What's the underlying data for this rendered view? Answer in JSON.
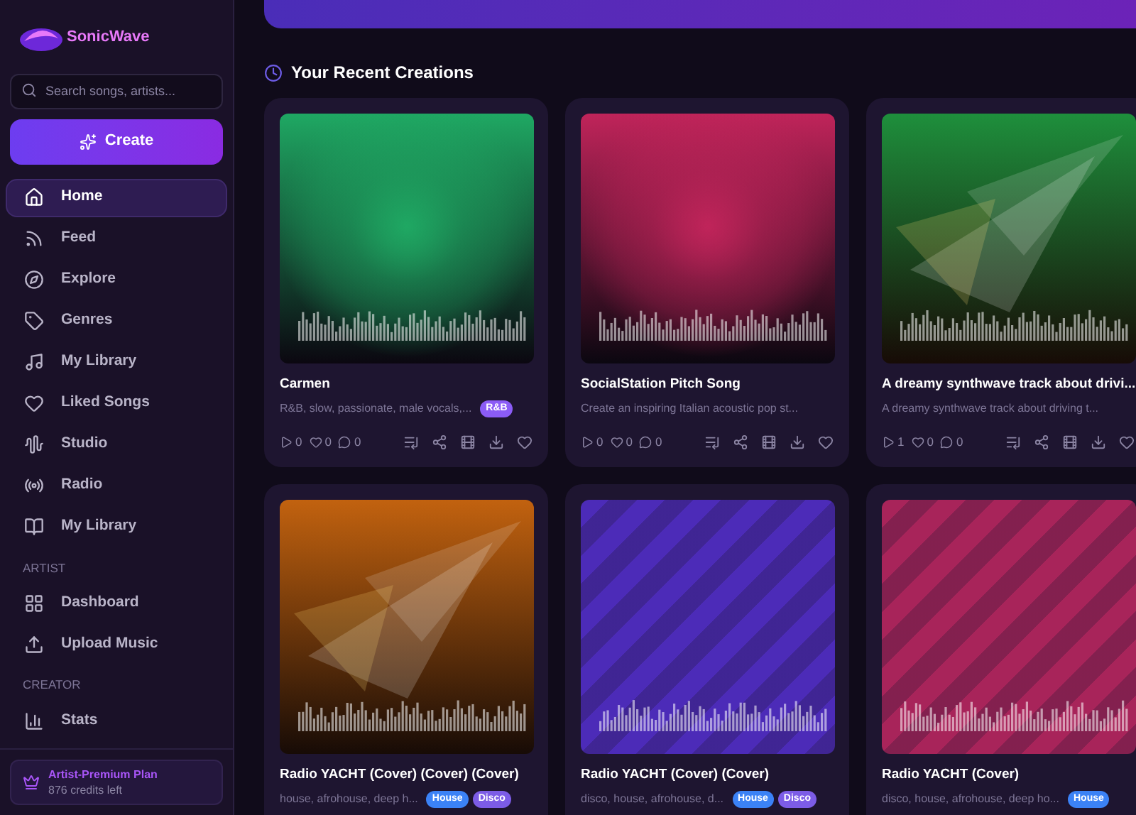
{
  "brand": {
    "name": "SonicWave"
  },
  "search": {
    "placeholder": "Search songs, artists..."
  },
  "create_button": {
    "label": "Create"
  },
  "nav": [
    {
      "label": "Home",
      "selected": true
    },
    {
      "label": "Feed",
      "selected": false
    },
    {
      "label": "Explore",
      "selected": false
    },
    {
      "label": "Genres",
      "selected": false
    },
    {
      "label": "My Library",
      "selected": false
    },
    {
      "label": "Liked Songs",
      "selected": false
    },
    {
      "label": "Studio",
      "selected": false
    },
    {
      "label": "Radio",
      "selected": false
    },
    {
      "label": "My Library",
      "selected": false
    }
  ],
  "sections": [
    {
      "title": "ARTIST",
      "items": [
        {
          "label": "Dashboard",
          "selected": false
        },
        {
          "label": "Upload Music",
          "selected": false
        }
      ]
    },
    {
      "title": "CREATOR",
      "items": [
        {
          "label": "Stats",
          "selected": false
        }
      ]
    }
  ],
  "plan": {
    "name": "Artist-Premium Plan",
    "credits": "876 credits left"
  },
  "heading": "Your Recent Creations",
  "tracks": [
    {
      "title": "Carmen",
      "description": "R&B, slow, passionate, male vocals,...",
      "color": "#1fa863",
      "tags": [
        {
          "label": "R&B",
          "color": "#8b5cf6"
        }
      ],
      "plays": "0",
      "likes": "0",
      "comments": "0"
    },
    {
      "title": "SocialStation Pitch Song",
      "description": "Create an inspiring Italian acoustic pop st...",
      "color": "#c0245a",
      "plays": "0",
      "likes": "0",
      "comments": "0"
    },
    {
      "title": "A dreamy synthwave track about drivi...",
      "description": "A dreamy synthwave track about driving t...",
      "color": "#1e8f3c",
      "plays": "1",
      "likes": "0",
      "comments": "0"
    },
    {
      "title": "Radio YACHT (Cover) (Cover) (Cover)",
      "description": "house, afrohouse, deep h...",
      "color": "#c2620f",
      "tags": [
        {
          "label": "House",
          "color": "#3b82f6"
        },
        {
          "label": "Disco",
          "color": "#7c5ce6"
        }
      ]
    },
    {
      "title": "Radio YACHT (Cover) (Cover)",
      "description": "disco, house, afrohouse, d...",
      "color": "#4c2bb8",
      "tags": [
        {
          "label": "House",
          "color": "#3b82f6"
        },
        {
          "label": "Disco",
          "color": "#7c5ce6"
        }
      ]
    },
    {
      "title": "Radio YACHT (Cover)",
      "description": "disco, house, afrohouse, deep ho...",
      "color": "#a8245a",
      "tags": [
        {
          "label": "House",
          "color": "#3b82f6"
        }
      ]
    }
  ]
}
